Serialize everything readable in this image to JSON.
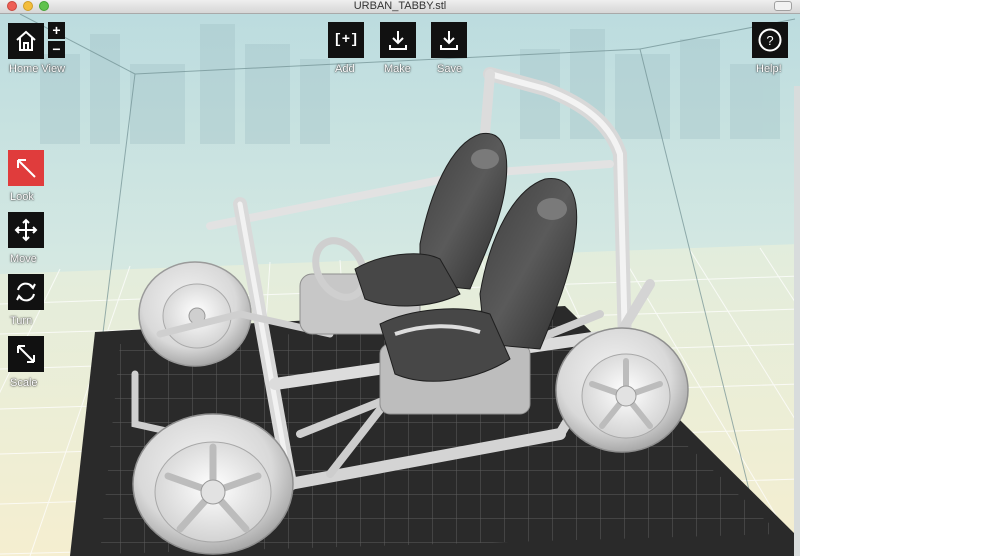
{
  "window": {
    "title": "URBAN_TABBY.stl"
  },
  "toolbar": {
    "home_label": "Home View",
    "zoom_in": "+",
    "zoom_out": "−",
    "add_label": "Add",
    "add_icon_text": "[+]",
    "make_label": "Make",
    "save_label": "Save",
    "help_label": "Help!",
    "help_icon_text": "?"
  },
  "side_tools": [
    {
      "label": "Look",
      "icon": "look-arrow-icon",
      "active": true
    },
    {
      "label": "Move",
      "icon": "move-arrows-icon",
      "active": false
    },
    {
      "label": "Turn",
      "icon": "rotate-icon",
      "active": false
    },
    {
      "label": "Scale",
      "icon": "scale-arrow-icon",
      "active": false
    }
  ],
  "colors": {
    "active_tool": "#e03c3c",
    "button_bg": "#111111",
    "build_plate": "#2a2a2a",
    "grid_line": "#ffffff",
    "model": "#e4e4e4"
  }
}
